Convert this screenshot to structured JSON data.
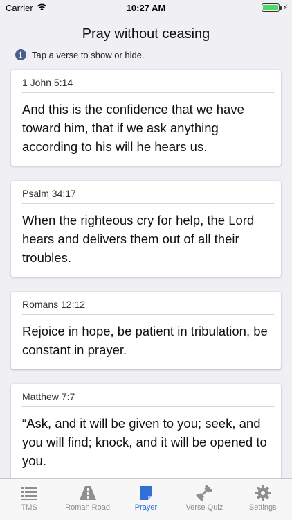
{
  "status_bar": {
    "carrier": "Carrier",
    "time": "10:27 AM",
    "battery_level": 1.0,
    "battery_color": "#4cd964"
  },
  "header": {
    "title": "Pray without ceasing",
    "hint": "Tap a verse to show or hide."
  },
  "verses": [
    {
      "reference": "1 John 5:14",
      "text": "And this is the confidence that we have toward him, that if we ask anything according to his will he hears us."
    },
    {
      "reference": "Psalm 34:17",
      "text": "When the righteous cry for help, the Lord hears and delivers them out of all their troubles."
    },
    {
      "reference": "Romans 12:12",
      "text": "Rejoice in hope, be patient in tribulation, be constant in prayer."
    },
    {
      "reference": "Matthew 7:7",
      "text": "“Ask, and it will be given to you; seek, and you will find; knock, and it will be opened to you."
    }
  ],
  "tabs": [
    {
      "label": "TMS",
      "icon": "list-icon"
    },
    {
      "label": "Roman Road",
      "icon": "road-icon"
    },
    {
      "label": "Prayer",
      "icon": "prayer-note-icon",
      "active": true
    },
    {
      "label": "Verse Quiz",
      "icon": "dumbbell-icon"
    },
    {
      "label": "Settings",
      "icon": "gear-icon"
    }
  ],
  "colors": {
    "accent": "#2f6fd6",
    "inactive_tab": "#8e8e93",
    "background": "#efeff4"
  }
}
